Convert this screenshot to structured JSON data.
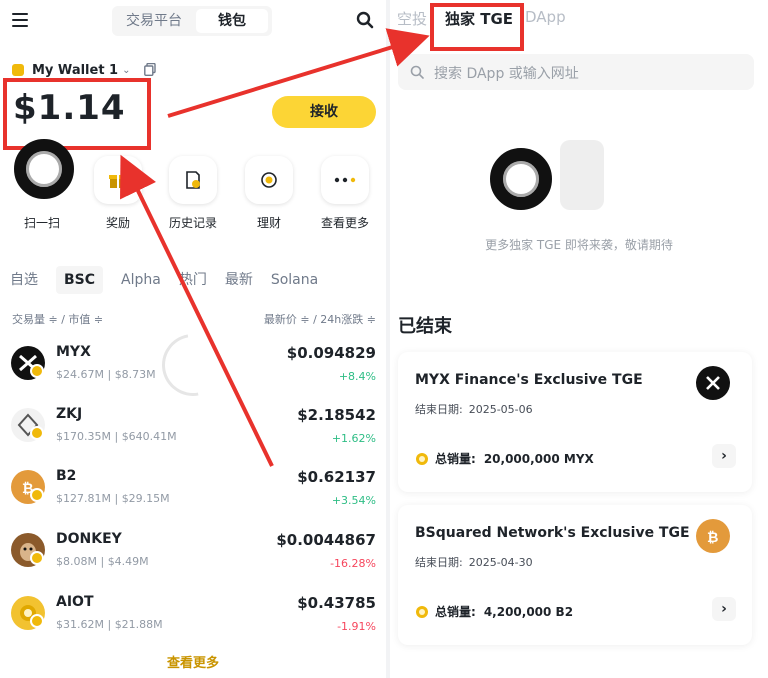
{
  "left": {
    "top_tabs": [
      "交易平台",
      "钱包"
    ],
    "wallet_name": "My Wallet 1",
    "balance": "$1.14",
    "receive_label": "接收",
    "quick_actions": [
      "扫一扫",
      "奖励",
      "历史记录",
      "理财",
      "查看更多"
    ],
    "chain_tabs": [
      "自选",
      "BSC",
      "Alpha",
      "热门",
      "最新",
      "Solana"
    ],
    "sort_left": "交易量 ≑ / 市值 ≑",
    "sort_right": "最新价 ≑ / 24h涨跌 ≑",
    "tokens": [
      {
        "symbol": "MYX",
        "volume": "$24.67M",
        "mcap": "$8.73M",
        "price": "$0.094829",
        "change": "+8.4%",
        "direction": "up",
        "logo_color": "#111111"
      },
      {
        "symbol": "ZKJ",
        "volume": "$170.35M",
        "mcap": "$640.41M",
        "price": "$2.18542",
        "change": "+1.62%",
        "direction": "up",
        "logo_color": "#f2f2f2"
      },
      {
        "symbol": "B2",
        "volume": "$127.81M",
        "mcap": "$29.15M",
        "price": "$0.62137",
        "change": "+3.54%",
        "direction": "up",
        "logo_color": "#e39a3b"
      },
      {
        "symbol": "DONKEY",
        "volume": "$8.08M",
        "mcap": "$4.49M",
        "price": "$0.0044867",
        "change": "-16.28%",
        "direction": "down",
        "logo_color": "#8b5a2b"
      },
      {
        "symbol": "AIOT",
        "volume": "$31.62M",
        "mcap": "$21.88M",
        "price": "$0.43785",
        "change": "-1.91%",
        "direction": "down",
        "logo_color": "#f2c230"
      }
    ],
    "view_more": "查看更多"
  },
  "right": {
    "tabs": [
      "空投",
      "独家 TGE",
      "DApp"
    ],
    "search_placeholder": "搜索 DApp 或输入网址",
    "empty_text": "更多独家 TGE 即将来袭，敬请期待",
    "ended_title": "已结束",
    "tges": [
      {
        "name": "MYX Finance's Exclusive TGE",
        "date_label": "结束日期:",
        "date": "2025-05-06",
        "supply_label": "总销量:",
        "supply": "20,000,000 MYX"
      },
      {
        "name": "BSquared Network's Exclusive TGE",
        "date_label": "结束日期:",
        "date": "2025-04-30",
        "supply_label": "总销量:",
        "supply": "4,200,000 B2"
      }
    ]
  },
  "colors": {
    "brand_yellow": "#fcd535",
    "annotation_red": "#e8322c",
    "up_green": "#2ebd85",
    "down_red": "#f6465d",
    "link_gold": "#c99400"
  },
  "icons": [
    "menu-icon",
    "search-icon",
    "wallet-icon",
    "copy-icon",
    "gift-icon",
    "history-icon",
    "earn-icon",
    "more-icon",
    "coin-icon",
    "chevron-right-icon"
  ]
}
